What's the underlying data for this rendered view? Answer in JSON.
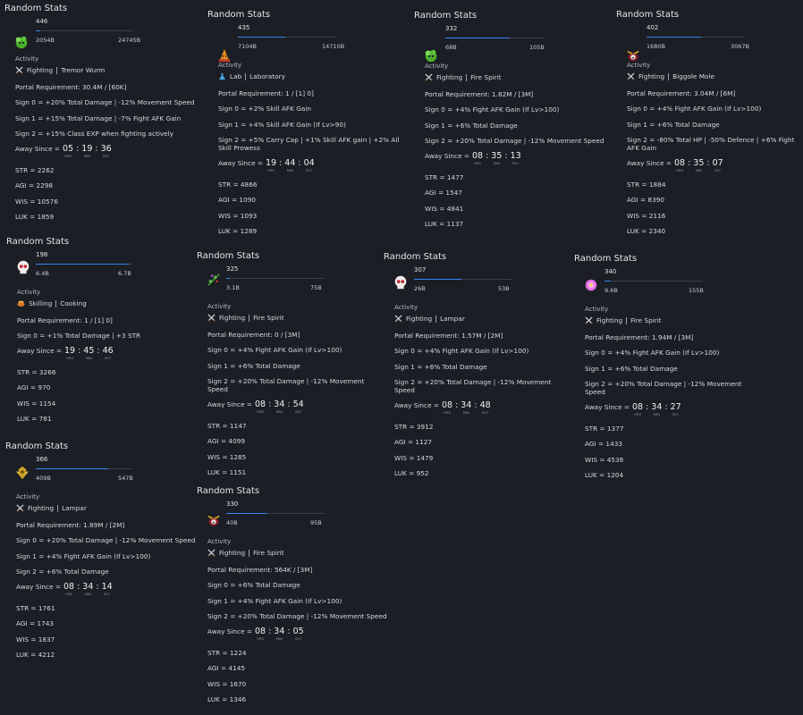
{
  "colors": {
    "background": "#1b1e24",
    "bar_track": "#3a3f49",
    "bar_fill": "#3b82f6",
    "text": "#d6d9de"
  },
  "labels": {
    "activity": "Activity",
    "away_since": "Away Since =",
    "hrs": "HRS",
    "min": "MIN",
    "sec": "SEC"
  },
  "cards": [
    {
      "title": "Random Stats",
      "level": "446",
      "bar_min": "2054B",
      "bar_max": "24745B",
      "bar_progress": 0.05,
      "monster_icon": "green-slime-icon",
      "activity_icon": "crossed-swords-icon",
      "activity_type": "Fighting",
      "activity_target": "Tremor Wurm",
      "lines": [
        "Portal Requirement: 30.4M / [60K]",
        "Sign 0 = +20% Total Damage | -12% Movement Speed",
        "Sign 1 = +15% Total Damage | -7% Fight AFK Gain",
        "Sign 2 = +15% Class EXP when fighting actively"
      ],
      "time": {
        "h": "05",
        "m": "19",
        "s": "36"
      },
      "stats": [
        "STR = 2262",
        "AGI = 2298",
        "WIS = 10576",
        "LUK = 1859"
      ]
    },
    {
      "title": "Random Stats",
      "level": "435",
      "bar_min": "7104B",
      "bar_max": "14710B",
      "bar_progress": 0.48,
      "monster_icon": "orange-slime-icon",
      "activity_icon": "flask-icon",
      "activity_type": "Lab",
      "activity_target": "Laboratory",
      "lines": [
        "Portal Requirement: 1 / [1] 0]",
        "Sign 0 = +2% Skill AFK Gain",
        "Sign 1 = +4% Skill AFK Gain (If Lv>90)",
        "Sign 2 = +5% Carry Cap | +1% Skill AFK gain | +2% All Skill Prowess"
      ],
      "time": {
        "h": "19",
        "m": "44",
        "s": "04"
      },
      "stats": [
        "STR = 4866",
        "AGI = 1090",
        "WIS = 1093",
        "LUK = 1289"
      ]
    },
    {
      "title": "Random Stats",
      "level": "332",
      "bar_min": "68B",
      "bar_max": "105B",
      "bar_progress": 0.65,
      "monster_icon": "green-slime-icon",
      "activity_icon": "crossed-swords-icon",
      "activity_type": "Fighting",
      "activity_target": "Fire Spirit",
      "lines": [
        "Portal Requirement: 1.82M / [3M]",
        "Sign 0 = +4% Fight AFK Gain (If Lv>100)",
        "Sign 1 = +6% Total Damage",
        "Sign 2 = +20% Total Damage | -12% Movement Speed"
      ],
      "time": {
        "h": "08",
        "m": "35",
        "s": "13"
      },
      "stats": [
        "STR = 1477",
        "AGI = 1547",
        "WIS = 4841",
        "LUK = 1137"
      ]
    },
    {
      "title": "Random Stats",
      "level": "402",
      "bar_min": "1680B",
      "bar_max": "3067B",
      "bar_progress": 0.55,
      "monster_icon": "mole-icon",
      "activity_icon": "crossed-swords-icon",
      "activity_type": "Fighting",
      "activity_target": "Biggole Mole",
      "lines": [
        "Portal Requirement: 3.04M / [6M]",
        "Sign 0 = +4% Fight AFK Gain (If Lv>100)",
        "Sign 1 = +6% Total Damage",
        "Sign 2 = -80% Total HP | -50% Defence | +6% Fight AFK Gain"
      ],
      "time": {
        "h": "08",
        "m": "35",
        "s": "07"
      },
      "stats": [
        "STR = 1884",
        "AGI = 8390",
        "WIS = 2116",
        "LUK = 2340"
      ]
    },
    {
      "title": "Random Stats",
      "level": "198",
      "bar_min": "6.4B",
      "bar_max": "6.7B",
      "bar_progress": 0.96,
      "monster_icon": "skull-icon",
      "activity_icon": "cooking-pot-icon",
      "activity_type": "Skilling",
      "activity_target": "Cooking",
      "lines": [
        "Portal Requirement: 1 / [1] 0]",
        "Sign 0 = +1% Total Damage | +3 STR"
      ],
      "time": {
        "h": "19",
        "m": "45",
        "s": "46"
      },
      "stats": [
        "STR = 3266",
        "AGI = 970",
        "WIS = 1154",
        "LUK = 781"
      ]
    },
    {
      "title": "Random Stats",
      "level": "325",
      "bar_min": "3.1B",
      "bar_max": "75B",
      "bar_progress": 0.04,
      "monster_icon": "vine-icon",
      "activity_icon": "crossed-swords-icon",
      "activity_type": "Fighting",
      "activity_target": "Fire Spirit",
      "lines": [
        "Portal Requirement: 0 / [3M]",
        "Sign 0 = +4% Fight AFK Gain (If Lv>100)",
        "Sign 1 = +6% Total Damage",
        "Sign 2 = +20% Total Damage | -12% Movement Speed"
      ],
      "time": {
        "h": "08",
        "m": "34",
        "s": "54"
      },
      "stats": [
        "STR = 1147",
        "AGI = 4099",
        "WIS = 1285",
        "LUK = 1151"
      ]
    },
    {
      "title": "Random Stats",
      "level": "307",
      "bar_min": "26B",
      "bar_max": "53B",
      "bar_progress": 0.48,
      "monster_icon": "skull-icon",
      "activity_icon": "crossed-swords-icon",
      "activity_type": "Fighting",
      "activity_target": "Lampar",
      "lines": [
        "Portal Requirement: 1.57M / [2M]",
        "Sign 0 = +4% Fight AFK Gain (If Lv>100)",
        "Sign 1 = +6% Total Damage",
        "Sign 2 = +20% Total Damage | -12% Movement Speed"
      ],
      "time": {
        "h": "08",
        "m": "34",
        "s": "48"
      },
      "stats": [
        "STR = 3912",
        "AGI = 1127",
        "WIS = 1479",
        "LUK = 952"
      ]
    },
    {
      "title": "Random Stats",
      "level": "340",
      "bar_min": "9.6B",
      "bar_max": "155B",
      "bar_progress": 0.06,
      "monster_icon": "pink-flower-icon",
      "activity_icon": "crossed-swords-icon",
      "activity_type": "Fighting",
      "activity_target": "Fire Spirit",
      "lines": [
        "Portal Requirement: 1.94M / [3M]",
        "Sign 0 = +4% Fight AFK Gain (If Lv>100)",
        "Sign 1 = +6% Total Damage",
        "Sign 2 = +20% Total Damage | -12% Movement Speed"
      ],
      "time": {
        "h": "08",
        "m": "34",
        "s": "27"
      },
      "stats": [
        "STR = 1377",
        "AGI = 1433",
        "WIS = 4538",
        "LUK = 1204"
      ]
    },
    {
      "title": "Random Stats",
      "level": "366",
      "bar_min": "409B",
      "bar_max": "547B",
      "bar_progress": 0.75,
      "monster_icon": "golden-crest-icon",
      "activity_icon": "crossed-swords-icon",
      "activity_type": "Fighting",
      "activity_target": "Lampar",
      "lines": [
        "Portal Requirement: 1.89M / [2M]",
        "Sign 0 = +20% Total Damage | -12% Movement Speed",
        "Sign 1 = +4% Fight AFK Gain (If Lv>100)",
        "Sign 2 = +6% Total Damage"
      ],
      "time": {
        "h": "08",
        "m": "34",
        "s": "14"
      },
      "stats": [
        "STR = 1761",
        "AGI = 1743",
        "WIS = 1837",
        "LUK = 4212"
      ]
    },
    {
      "title": "Random Stats",
      "level": "330",
      "bar_min": "40B",
      "bar_max": "95B",
      "bar_progress": 0.42,
      "monster_icon": "mole-icon",
      "activity_icon": "crossed-swords-icon",
      "activity_type": "Fighting",
      "activity_target": "Fire Spirit",
      "lines": [
        "Portal Requirement: 564K / [3M]",
        "Sign 0 = +6% Total Damage",
        "Sign 1 = +4% Fight AFK Gain (If Lv>100)",
        "Sign 2 = +20% Total Damage | -12% Movement Speed"
      ],
      "time": {
        "h": "08",
        "m": "34",
        "s": "05"
      },
      "stats": [
        "STR = 1224",
        "AGI = 4145",
        "WIS = 1670",
        "LUK = 1346"
      ]
    }
  ]
}
